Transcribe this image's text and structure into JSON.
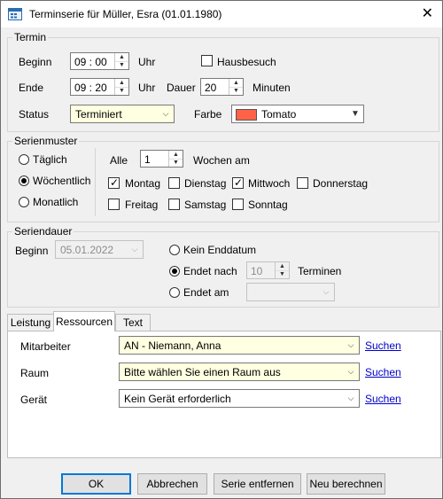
{
  "window": {
    "title": "Terminserie für Müller, Esra (01.01.1980)",
    "icon": "calendar-icon"
  },
  "termin": {
    "legend": "Termin",
    "beginn_label": "Beginn",
    "beginn_value": "09 : 00",
    "beginn_unit": "Uhr",
    "ende_label": "Ende",
    "ende_value": "09 : 20",
    "ende_unit": "Uhr",
    "dauer_label": "Dauer",
    "dauer_value": "20",
    "dauer_unit": "Minuten",
    "hausbesuch_label": "Hausbesuch",
    "hausbesuch_checked": false,
    "status_label": "Status",
    "status_value": "Terminiert",
    "farbe_label": "Farbe",
    "farbe_value": "Tomato",
    "farbe_color": "#ff6347"
  },
  "serienmuster": {
    "legend": "Serienmuster",
    "options": [
      "Täglich",
      "Wöchentlich",
      "Monatlich"
    ],
    "selected": "Wöchentlich",
    "alle_label": "Alle",
    "alle_value": "1",
    "wochen_am_label": "Wochen am",
    "days": [
      {
        "label": "Montag",
        "checked": true
      },
      {
        "label": "Dienstag",
        "checked": false
      },
      {
        "label": "Mittwoch",
        "checked": true
      },
      {
        "label": "Donnerstag",
        "checked": false
      },
      {
        "label": "Freitag",
        "checked": false
      },
      {
        "label": "Samstag",
        "checked": false
      },
      {
        "label": "Sonntag",
        "checked": false
      }
    ]
  },
  "seriendauer": {
    "legend": "Seriendauer",
    "beginn_label": "Beginn",
    "beginn_value": "05.01.2022",
    "kein_enddatum_label": "Kein Enddatum",
    "endet_nach_label": "Endet nach",
    "endet_nach_value": "10",
    "terminen_label": "Terminen",
    "endet_am_label": "Endet am",
    "selected": "Endet nach"
  },
  "tabs": [
    {
      "label": "Leistung",
      "active": false
    },
    {
      "label": "Ressourcen",
      "active": true
    },
    {
      "label": "Text",
      "active": false
    }
  ],
  "ressourcen": {
    "mitarbeiter_label": "Mitarbeiter",
    "mitarbeiter_value": "AN - Niemann, Anna",
    "raum_label": "Raum",
    "raum_value": "Bitte wählen Sie einen Raum aus",
    "geraet_label": "Gerät",
    "geraet_value": "Kein Gerät erforderlich",
    "suchen_label": "Suchen"
  },
  "buttons": {
    "ok": "OK",
    "abbrechen": "Abbrechen",
    "serie_entfernen": "Serie entfernen",
    "neu_berechnen": "Neu berechnen"
  }
}
